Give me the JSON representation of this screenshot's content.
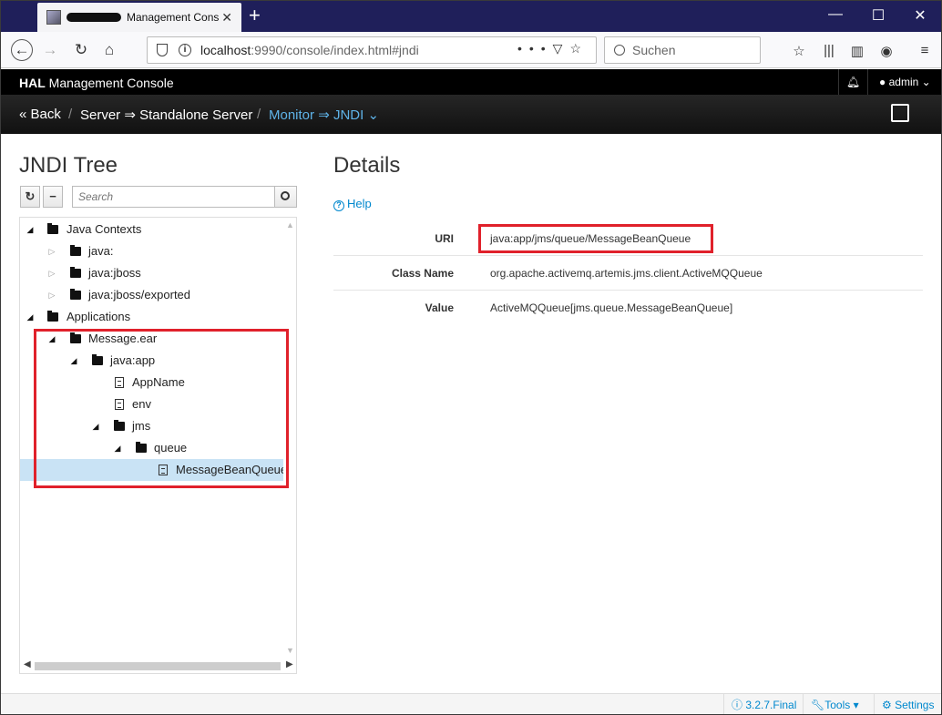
{
  "browser": {
    "tab_title": "Management Cons",
    "url_host": "localhost",
    "url_rest": ":9990/console/index.html#jndi",
    "search_placeholder": "Suchen"
  },
  "header": {
    "brand_bold": "HAL",
    "brand_rest": " Management Console",
    "user": "admin"
  },
  "breadcrumb": {
    "back": "Back",
    "server": "Server",
    "server_detail": "Standalone Server",
    "monitor": "Monitor",
    "jndi": "JNDI"
  },
  "tree_panel": {
    "title": "JNDI Tree",
    "search_placeholder": "Search",
    "nodes": [
      {
        "label": "Java Contexts",
        "toggle": "open",
        "icon": "folder-icon"
      },
      {
        "label": "java:",
        "toggle": "closed",
        "icon": "folder-icon"
      },
      {
        "label": "java:jboss",
        "toggle": "closed",
        "icon": "folder-icon"
      },
      {
        "label": "java:jboss/exported",
        "toggle": "closed",
        "icon": "folder-icon"
      },
      {
        "label": "Applications",
        "toggle": "open",
        "icon": "folder-icon"
      },
      {
        "label": "Message.ear",
        "toggle": "open",
        "icon": "folder-icon"
      },
      {
        "label": "java:app",
        "toggle": "open",
        "icon": "folder-icon"
      },
      {
        "label": "AppName",
        "toggle": "none",
        "icon": "file-icon"
      },
      {
        "label": "env",
        "toggle": "none",
        "icon": "file-icon"
      },
      {
        "label": "jms",
        "toggle": "open",
        "icon": "folder-icon"
      },
      {
        "label": "queue",
        "toggle": "open",
        "icon": "folder-icon"
      },
      {
        "label": "MessageBeanQueue",
        "toggle": "none",
        "icon": "file-icon",
        "selected": true
      }
    ]
  },
  "details": {
    "title": "Details",
    "help": "Help",
    "rows": [
      {
        "key": "URI",
        "value": "java:app/jms/queue/MessageBeanQueue"
      },
      {
        "key": "Class Name",
        "value": "org.apache.activemq.artemis.jms.client.ActiveMQQueue"
      },
      {
        "key": "Value",
        "value": "ActiveMQQueue[jms.queue.MessageBeanQueue]"
      }
    ]
  },
  "footer": {
    "version": "3.2.7.Final",
    "tools": "Tools",
    "settings": "Settings"
  },
  "colors": {
    "highlight": "#e0212b",
    "link": "#0088ce",
    "selection": "#c9e3f5"
  }
}
